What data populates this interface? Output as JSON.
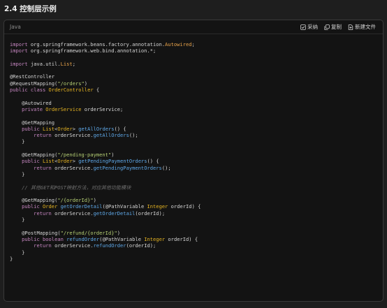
{
  "section_title": "2.4 控制层示例",
  "code_block": {
    "language": "Java",
    "actions": {
      "adopt": "采纳",
      "copy": "复制",
      "new_file": "新建文件"
    },
    "lines": [
      [
        {
          "t": "kw",
          "v": "import"
        },
        {
          "t": "plain",
          "v": " org.springframework.beans.factory.annotation."
        },
        {
          "t": "imp",
          "v": "Autowired"
        },
        {
          "t": "plain",
          "v": ";"
        }
      ],
      [
        {
          "t": "kw",
          "v": "import"
        },
        {
          "t": "plain",
          "v": " org.springframework.web.bind.annotation.*;"
        }
      ],
      [],
      [
        {
          "t": "kw",
          "v": "import"
        },
        {
          "t": "plain",
          "v": " java.util."
        },
        {
          "t": "imp",
          "v": "List"
        },
        {
          "t": "plain",
          "v": ";"
        }
      ],
      [],
      [
        {
          "t": "ann",
          "v": "@RestController"
        }
      ],
      [
        {
          "t": "ann",
          "v": "@RequestMapping("
        },
        {
          "t": "str",
          "v": "\"/orders\""
        },
        {
          "t": "ann",
          "v": ")"
        }
      ],
      [
        {
          "t": "kw",
          "v": "public"
        },
        {
          "t": "plain",
          "v": " "
        },
        {
          "t": "kw",
          "v": "class"
        },
        {
          "t": "plain",
          "v": " "
        },
        {
          "t": "type",
          "v": "OrderController"
        },
        {
          "t": "plain",
          "v": " {"
        }
      ],
      [],
      [
        {
          "t": "plain",
          "v": "    "
        },
        {
          "t": "ann",
          "v": "@Autowired"
        }
      ],
      [
        {
          "t": "plain",
          "v": "    "
        },
        {
          "t": "kw",
          "v": "private"
        },
        {
          "t": "plain",
          "v": " "
        },
        {
          "t": "type",
          "v": "OrderService"
        },
        {
          "t": "plain",
          "v": " orderService;"
        }
      ],
      [],
      [
        {
          "t": "plain",
          "v": "    "
        },
        {
          "t": "ann",
          "v": "@GetMapping"
        }
      ],
      [
        {
          "t": "plain",
          "v": "    "
        },
        {
          "t": "kw",
          "v": "public"
        },
        {
          "t": "plain",
          "v": " "
        },
        {
          "t": "type",
          "v": "List"
        },
        {
          "t": "plain",
          "v": "<"
        },
        {
          "t": "type",
          "v": "Order"
        },
        {
          "t": "plain",
          "v": "> "
        },
        {
          "t": "fn",
          "v": "getAllOrders"
        },
        {
          "t": "plain",
          "v": "() {"
        }
      ],
      [
        {
          "t": "plain",
          "v": "        "
        },
        {
          "t": "kw",
          "v": "return"
        },
        {
          "t": "plain",
          "v": " orderService."
        },
        {
          "t": "fn",
          "v": "getAllOrders"
        },
        {
          "t": "plain",
          "v": "();"
        }
      ],
      [
        {
          "t": "plain",
          "v": "    }"
        }
      ],
      [],
      [
        {
          "t": "plain",
          "v": "    "
        },
        {
          "t": "ann",
          "v": "@GetMapping("
        },
        {
          "t": "str",
          "v": "\"/pending-payment\""
        },
        {
          "t": "ann",
          "v": ")"
        }
      ],
      [
        {
          "t": "plain",
          "v": "    "
        },
        {
          "t": "kw",
          "v": "public"
        },
        {
          "t": "plain",
          "v": " "
        },
        {
          "t": "type",
          "v": "List"
        },
        {
          "t": "plain",
          "v": "<"
        },
        {
          "t": "type",
          "v": "Order"
        },
        {
          "t": "plain",
          "v": "> "
        },
        {
          "t": "fn",
          "v": "getPendingPaymentOrders"
        },
        {
          "t": "plain",
          "v": "() {"
        }
      ],
      [
        {
          "t": "plain",
          "v": "        "
        },
        {
          "t": "kw",
          "v": "return"
        },
        {
          "t": "plain",
          "v": " orderService."
        },
        {
          "t": "fn",
          "v": "getPendingPaymentOrders"
        },
        {
          "t": "plain",
          "v": "();"
        }
      ],
      [
        {
          "t": "plain",
          "v": "    }"
        }
      ],
      [],
      [
        {
          "t": "plain",
          "v": "    "
        },
        {
          "t": "cmt",
          "v": "// 其他GET和POST映射方法，对应其他功能模块"
        }
      ],
      [],
      [
        {
          "t": "plain",
          "v": "    "
        },
        {
          "t": "ann",
          "v": "@GetMapping("
        },
        {
          "t": "str",
          "v": "\"/{orderId}\""
        },
        {
          "t": "ann",
          "v": ")"
        }
      ],
      [
        {
          "t": "plain",
          "v": "    "
        },
        {
          "t": "kw",
          "v": "public"
        },
        {
          "t": "plain",
          "v": " "
        },
        {
          "t": "type",
          "v": "Order"
        },
        {
          "t": "plain",
          "v": " "
        },
        {
          "t": "fn",
          "v": "getOrderDetail"
        },
        {
          "t": "plain",
          "v": "(@PathVariable "
        },
        {
          "t": "type",
          "v": "Integer"
        },
        {
          "t": "plain",
          "v": " orderId) {"
        }
      ],
      [
        {
          "t": "plain",
          "v": "        "
        },
        {
          "t": "kw",
          "v": "return"
        },
        {
          "t": "plain",
          "v": " orderService."
        },
        {
          "t": "fn",
          "v": "getOrderDetail"
        },
        {
          "t": "plain",
          "v": "(orderId);"
        }
      ],
      [
        {
          "t": "plain",
          "v": "    }"
        }
      ],
      [],
      [
        {
          "t": "plain",
          "v": "    "
        },
        {
          "t": "ann",
          "v": "@PostMapping("
        },
        {
          "t": "str",
          "v": "\"/refund/{orderId}\""
        },
        {
          "t": "ann",
          "v": ")"
        }
      ],
      [
        {
          "t": "plain",
          "v": "    "
        },
        {
          "t": "kw",
          "v": "public"
        },
        {
          "t": "plain",
          "v": " "
        },
        {
          "t": "kw",
          "v": "boolean"
        },
        {
          "t": "plain",
          "v": " "
        },
        {
          "t": "fn",
          "v": "refundOrder"
        },
        {
          "t": "plain",
          "v": "(@PathVariable "
        },
        {
          "t": "type",
          "v": "Integer"
        },
        {
          "t": "plain",
          "v": " orderId) {"
        }
      ],
      [
        {
          "t": "plain",
          "v": "        "
        },
        {
          "t": "kw",
          "v": "return"
        },
        {
          "t": "plain",
          "v": " orderService."
        },
        {
          "t": "fn",
          "v": "refundOrder"
        },
        {
          "t": "plain",
          "v": "(orderId);"
        }
      ],
      [
        {
          "t": "plain",
          "v": "    }"
        }
      ],
      [
        {
          "t": "plain",
          "v": "}"
        }
      ]
    ]
  },
  "colors": {
    "background": "#1e1e1e",
    "code_background": "#131313",
    "keyword": "#c586c0",
    "type": "#e6b422",
    "string": "#b5cf74",
    "function": "#5fa8e8",
    "comment": "#6f6f6f"
  },
  "icons": {
    "adopt": "checkbox-icon",
    "copy": "copy-icon",
    "new_file": "new-file-icon"
  }
}
